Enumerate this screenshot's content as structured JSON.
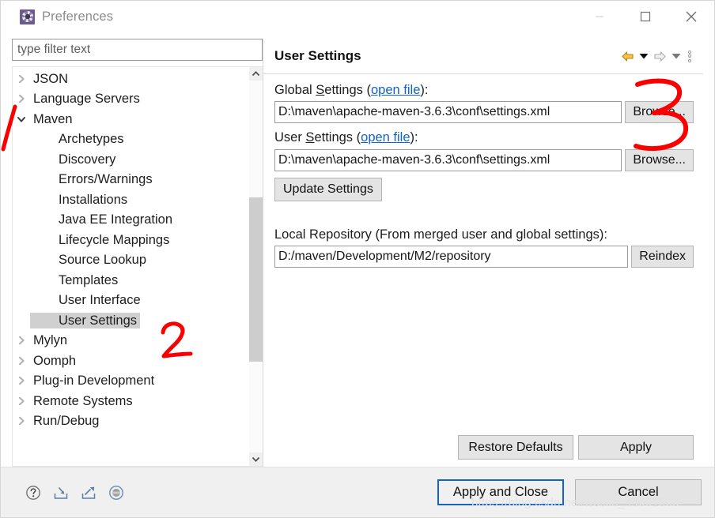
{
  "window": {
    "title": "Preferences",
    "app_icon": "gear-icon",
    "controls": {
      "minimize": "minimize-icon",
      "maximize": "maximize-icon",
      "close": "close-icon"
    }
  },
  "sidebar": {
    "filter": {
      "placeholder": "type filter text",
      "value": ""
    },
    "items": [
      {
        "label": "JSON",
        "level": 0,
        "expandable": true,
        "expanded": false,
        "selected": false
      },
      {
        "label": "Language Servers",
        "level": 0,
        "expandable": true,
        "expanded": false,
        "selected": false
      },
      {
        "label": "Maven",
        "level": 0,
        "expandable": true,
        "expanded": true,
        "selected": false
      },
      {
        "label": "Archetypes",
        "level": 1,
        "expandable": false,
        "expanded": false,
        "selected": false
      },
      {
        "label": "Discovery",
        "level": 1,
        "expandable": false,
        "expanded": false,
        "selected": false
      },
      {
        "label": "Errors/Warnings",
        "level": 1,
        "expandable": false,
        "expanded": false,
        "selected": false
      },
      {
        "label": "Installations",
        "level": 1,
        "expandable": false,
        "expanded": false,
        "selected": false
      },
      {
        "label": "Java EE Integration",
        "level": 1,
        "expandable": false,
        "expanded": false,
        "selected": false
      },
      {
        "label": "Lifecycle Mappings",
        "level": 1,
        "expandable": false,
        "expanded": false,
        "selected": false
      },
      {
        "label": "Source Lookup",
        "level": 1,
        "expandable": false,
        "expanded": false,
        "selected": false
      },
      {
        "label": "Templates",
        "level": 1,
        "expandable": false,
        "expanded": false,
        "selected": false
      },
      {
        "label": "User Interface",
        "level": 1,
        "expandable": false,
        "expanded": false,
        "selected": false
      },
      {
        "label": "User Settings",
        "level": 1,
        "expandable": false,
        "expanded": false,
        "selected": true
      },
      {
        "label": "Mylyn",
        "level": 0,
        "expandable": true,
        "expanded": false,
        "selected": false
      },
      {
        "label": "Oomph",
        "level": 0,
        "expandable": true,
        "expanded": false,
        "selected": false
      },
      {
        "label": "Plug-in Development",
        "level": 0,
        "expandable": true,
        "expanded": false,
        "selected": false
      },
      {
        "label": "Remote Systems",
        "level": 0,
        "expandable": true,
        "expanded": false,
        "selected": false
      },
      {
        "label": "Run/Debug",
        "level": 0,
        "expandable": true,
        "expanded": false,
        "selected": false
      }
    ],
    "scrollbar": {
      "up_arrow": "chevron-up-icon",
      "down_arrow": "chevron-down-icon"
    }
  },
  "page": {
    "title": "User Settings",
    "nav": {
      "back": "back-arrow-icon",
      "back_menu": "chevron-down-icon",
      "forward": "forward-arrow-icon",
      "forward_menu": "chevron-down-icon",
      "menu": "vertical-dots-icon"
    },
    "global_settings": {
      "label_prefix": "Global ",
      "label_underlined": "S",
      "label_suffix": "ettings (",
      "link": "open file",
      "label_end": "):",
      "value": "D:\\maven\\apache-maven-3.6.3\\conf\\settings.xml",
      "browse_label": "Browse..."
    },
    "user_settings": {
      "label_prefix": "User ",
      "label_underlined": "S",
      "label_suffix": "ettings (",
      "link": "open file",
      "label_end": "):",
      "value": "D:\\maven\\apache-maven-3.6.3\\conf\\settings.xml",
      "browse_label": "Browse..."
    },
    "update_settings_label": "Update Settings",
    "local_repository": {
      "label": "Local Repository (From merged user and global settings):",
      "value": "D:/maven/Development/M2/repository",
      "reindex_label": "Reindex"
    },
    "restore_defaults_label": "Restore Defaults",
    "apply_label": "Apply"
  },
  "bottom_bar": {
    "icons": [
      {
        "name": "help-icon"
      },
      {
        "name": "import-icon"
      },
      {
        "name": "export-icon"
      },
      {
        "name": "oomph-record-icon"
      }
    ],
    "apply_and_close_label": "Apply and Close",
    "cancel_label": "Cancel",
    "watermark": "https://blog.csdn.net/weixin_44001568"
  },
  "annotations": [
    {
      "name": "annotation-1",
      "text": "1",
      "color": "#fa0000"
    },
    {
      "name": "annotation-2",
      "text": "2",
      "color": "#fa0000"
    },
    {
      "name": "annotation-3",
      "text": "3",
      "color": "#fa0000"
    }
  ],
  "colors": {
    "accent": "#1263c2",
    "link": "#1263c2",
    "annotation": "#fa0000",
    "selection": "#d0d0d0",
    "button_face": "#e4e4e4"
  }
}
